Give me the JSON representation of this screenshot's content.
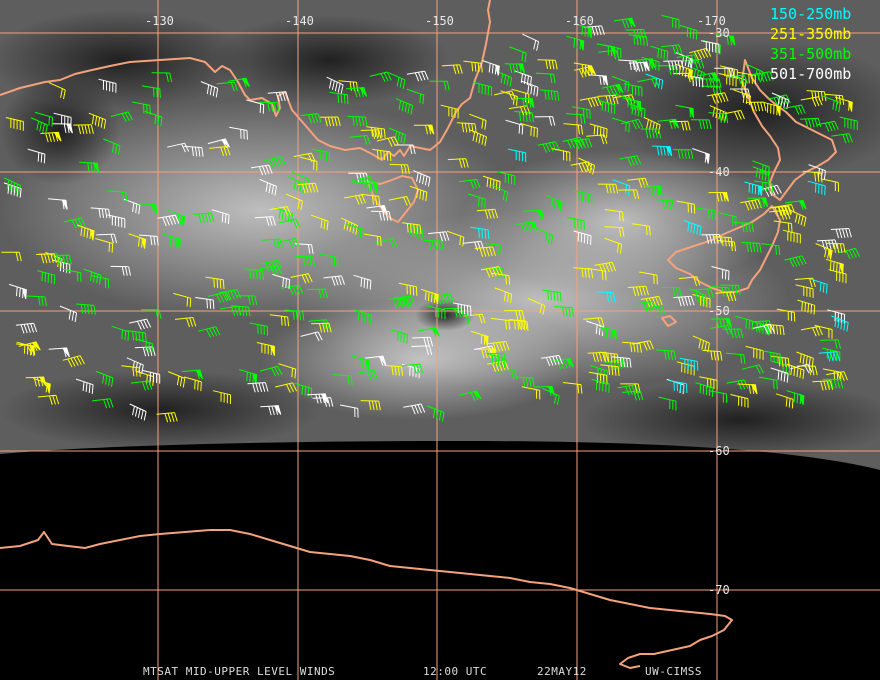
{
  "map": {
    "longitude_labels": [
      "-130",
      "-140",
      "-150",
      "-160",
      "-170"
    ],
    "latitude_labels": [
      "-30",
      "-40",
      "-50",
      "-60",
      "-70"
    ],
    "grid_color": "#f4a27c",
    "coast_color": "#f4a27c"
  },
  "legend": {
    "items": [
      {
        "label": "150-250mb",
        "color": "#00ffff"
      },
      {
        "label": "251-350mb",
        "color": "#ffff00"
      },
      {
        "label": "351-500mb",
        "color": "#00ff00"
      },
      {
        "label": "501-700mb",
        "color": "#ffffff"
      }
    ]
  },
  "footer": {
    "product": "MTSAT MID-UPPER LEVEL WINDS",
    "time": "12:00 UTC",
    "date": "22MAY12",
    "source": "UW-CIMSS"
  }
}
